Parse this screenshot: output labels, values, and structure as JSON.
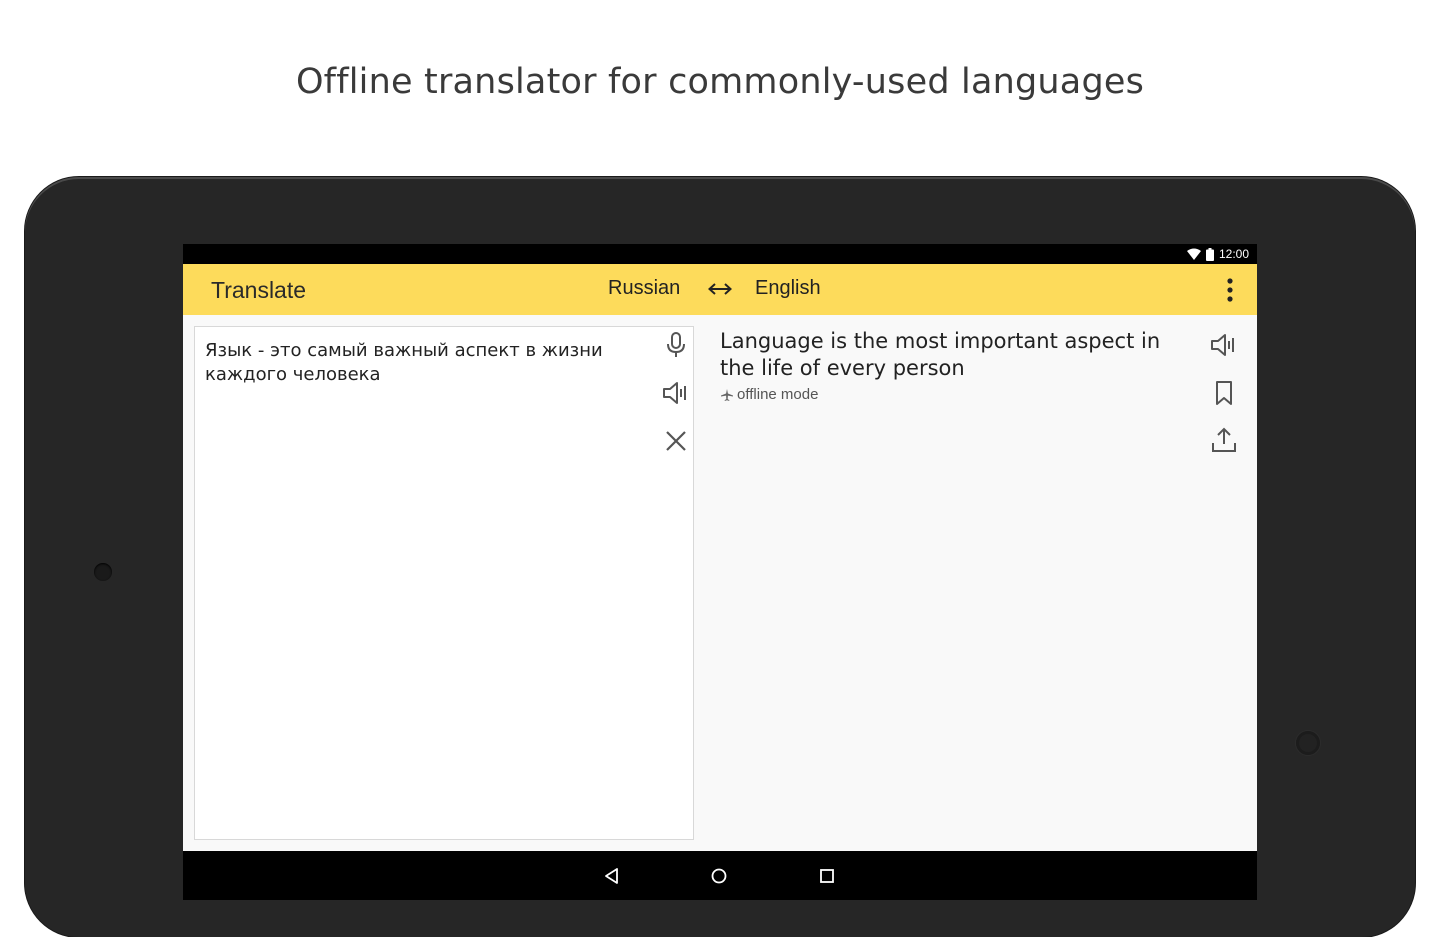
{
  "headline": "Offline translator for commonly-used languages",
  "status_bar": {
    "time": "12:00",
    "icons": [
      "wifi-icon",
      "battery-icon"
    ]
  },
  "app_bar": {
    "title": "Translate",
    "source_language": "Russian",
    "target_language": "English",
    "swap_icon": "swap-arrows-icon",
    "menu_icon": "more-vertical-icon",
    "background": "#fddb5b"
  },
  "input": {
    "text": "Язык - это самый важный аспект в жизни каждого человека",
    "icons": [
      "microphone-icon",
      "speaker-icon",
      "clear-icon"
    ]
  },
  "output": {
    "text": "Language is the most important aspect in the life of every person",
    "mode_label": "offline mode",
    "icons": [
      "speaker-icon",
      "bookmark-icon",
      "share-icon"
    ]
  },
  "nav_bar": {
    "icons": [
      "back-icon",
      "home-icon",
      "recents-icon"
    ]
  }
}
